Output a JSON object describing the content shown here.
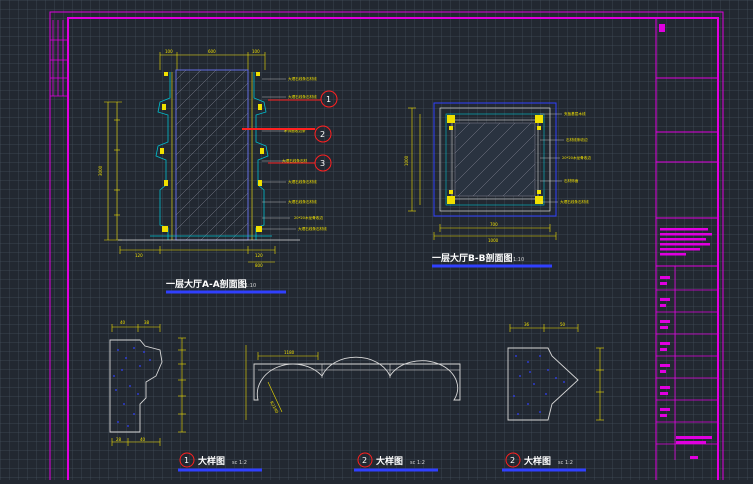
{
  "drawing": {
    "title_section_a": "一层大厅A-A剖面图",
    "scale_section_a": "sc 1:10",
    "title_section_b": "一层大厅B-B剖面图",
    "scale_section_b": "sc 1:10",
    "detail_1_number": "1",
    "detail_1_title": "大样图",
    "detail_1_scale": "sc 1:2",
    "detail_2a_number": "2",
    "detail_2a_title": "大样图",
    "detail_2a_scale": "sc 1:2",
    "detail_2b_number": "2",
    "detail_2b_title": "大样图",
    "detail_2b_scale": "sc 1:2",
    "callout_1": "1",
    "callout_2": "2",
    "callout_3": "3"
  },
  "section_a_annotations": [
    "大理石线条石材线",
    "大理石线条石材线",
    "木饰面收边条",
    "大理石线条石材",
    "大理石线条石材线",
    "大理石线条石材线",
    "20*20木龙骨收边",
    "大理石线条石材线"
  ],
  "section_b_annotations": [
    "夹板基层木线",
    "石材线条收边",
    "20*20木龙骨收边",
    "石材饰面",
    "大理石线条石材线"
  ],
  "dims": {
    "a_top_1": "100",
    "a_top_2": "600",
    "a_top_3": "100",
    "a_left_total": "3000",
    "a_bottom_1": "120",
    "a_bottom_2": "120",
    "a_bottom_3": "800",
    "b_top": "700",
    "b_top_2": "1000",
    "b_left": "1000",
    "d1_top_1": "40",
    "d1_top_2": "38",
    "d1_bot_1": "28",
    "d1_bot_2": "40",
    "arch_span": "1180",
    "arch_r": "R2140",
    "d3_top_1": "36",
    "d3_top_2": "50"
  },
  "colors": {
    "border": "#e000e0",
    "dimension": "#f0e000",
    "outline": "#d8d8d8",
    "panel": "#3040ff",
    "title_underline": "#3040ff",
    "callout": "#ff2020"
  }
}
